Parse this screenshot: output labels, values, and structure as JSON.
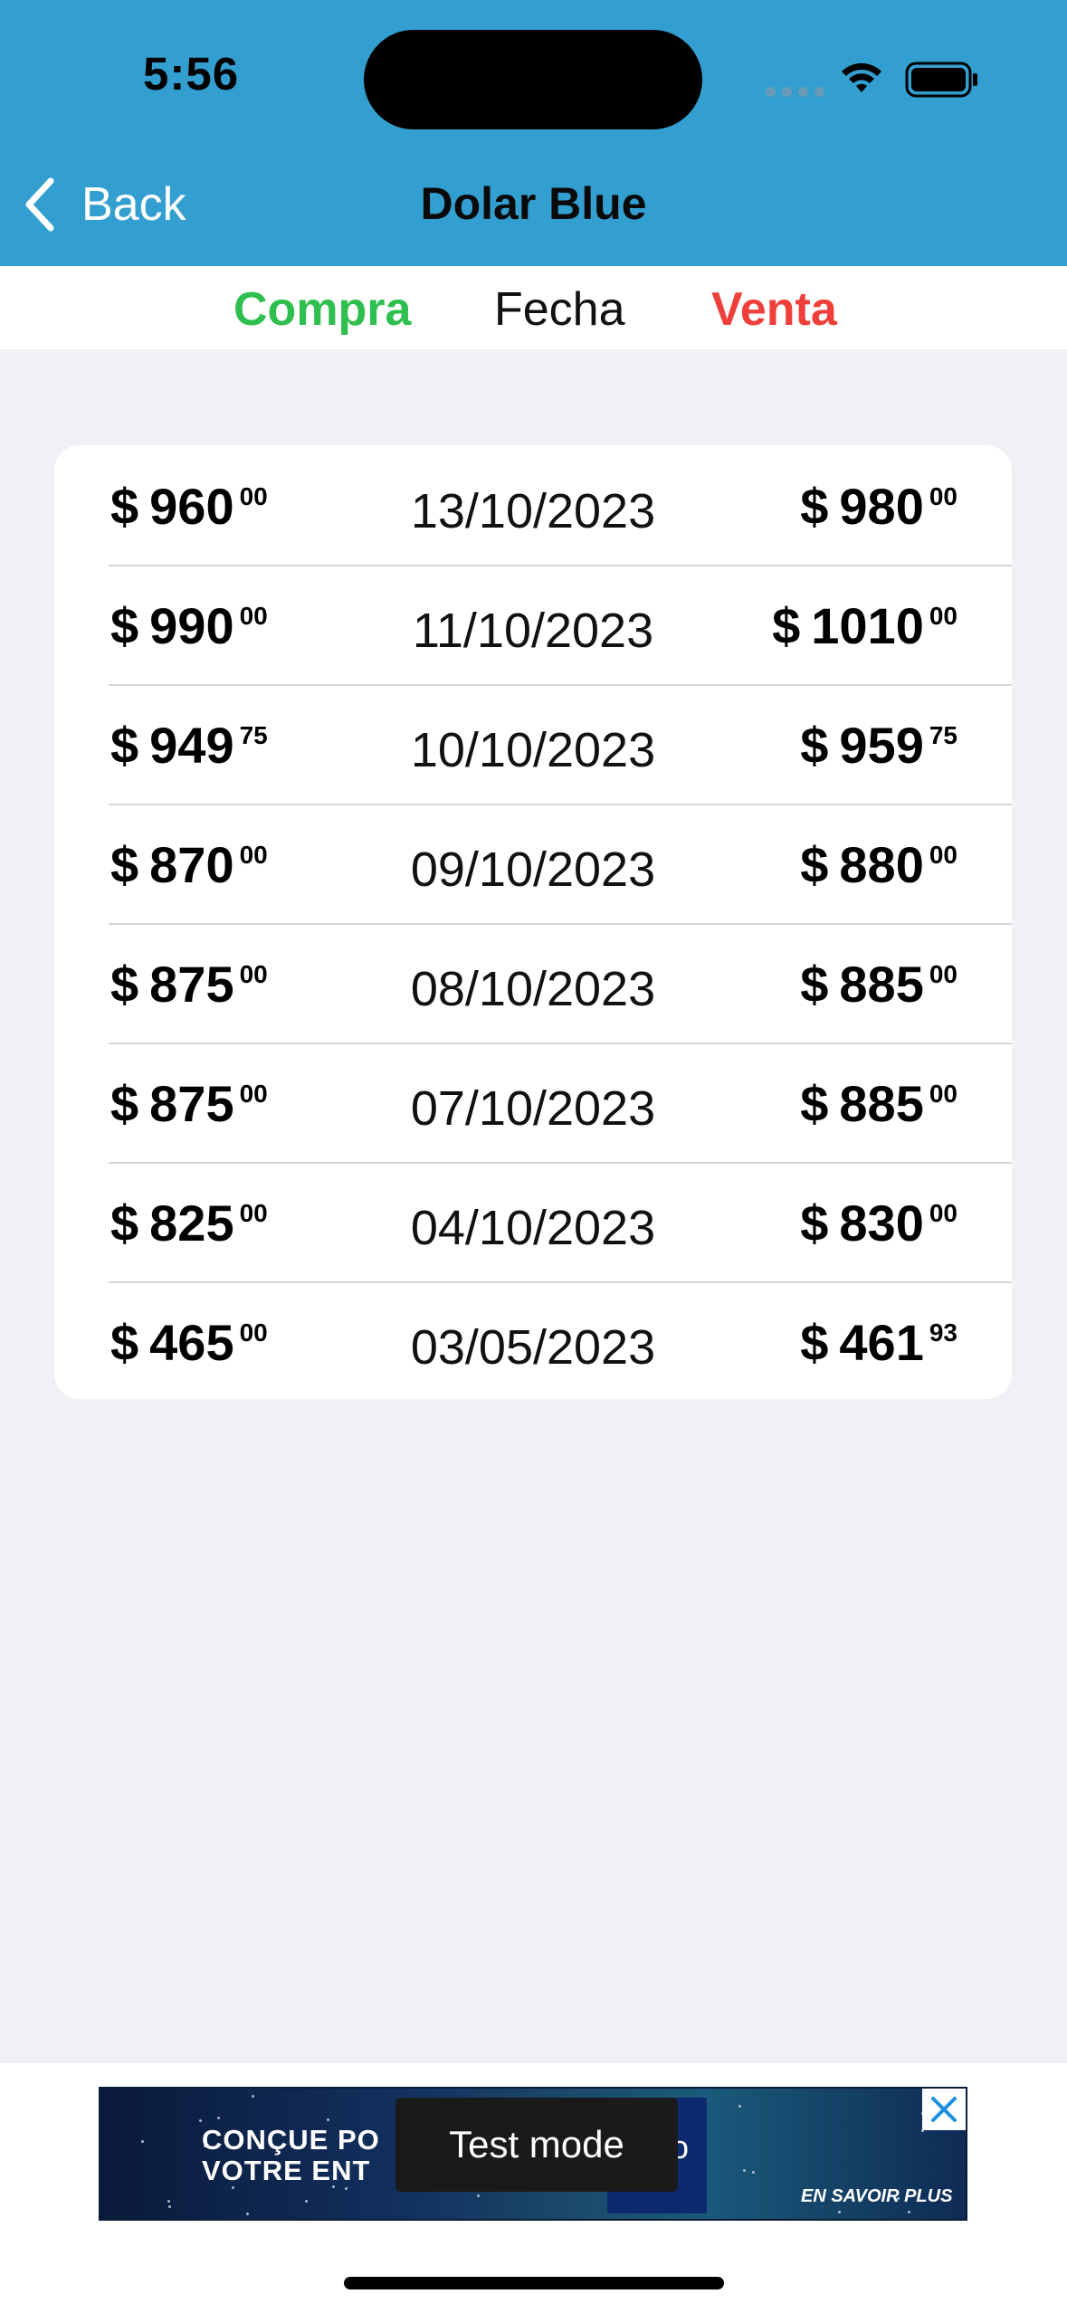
{
  "status_bar": {
    "time": "5:56",
    "icons": [
      "cellular-dots-icon",
      "wifi-icon",
      "battery-icon"
    ]
  },
  "nav": {
    "back_label": "Back",
    "title": "Dolar Blue"
  },
  "columns": {
    "buy": "Compra",
    "date": "Fecha",
    "sell": "Venta"
  },
  "colors": {
    "header_bg": "#339fd0",
    "buy": "#2fbf4f",
    "sell": "#ef3f3a",
    "background": "#f0f0f5"
  },
  "currency_symbol": "$",
  "rates": [
    {
      "buy_int": "960",
      "buy_dec": "00",
      "date": "13/10/2023",
      "sell_int": "980",
      "sell_dec": "00"
    },
    {
      "buy_int": "990",
      "buy_dec": "00",
      "date": "11/10/2023",
      "sell_int": "1010",
      "sell_dec": "00"
    },
    {
      "buy_int": "949",
      "buy_dec": "75",
      "date": "10/10/2023",
      "sell_int": "959",
      "sell_dec": "75"
    },
    {
      "buy_int": "870",
      "buy_dec": "00",
      "date": "09/10/2023",
      "sell_int": "880",
      "sell_dec": "00"
    },
    {
      "buy_int": "875",
      "buy_dec": "00",
      "date": "08/10/2023",
      "sell_int": "885",
      "sell_dec": "00"
    },
    {
      "buy_int": "875",
      "buy_dec": "00",
      "date": "07/10/2023",
      "sell_int": "885",
      "sell_dec": "00"
    },
    {
      "buy_int": "825",
      "buy_dec": "00",
      "date": "04/10/2023",
      "sell_int": "830",
      "sell_dec": "00"
    },
    {
      "buy_int": "465",
      "buy_dec": "00",
      "date": "03/05/2023",
      "sell_int": "461",
      "sell_dec": "93"
    }
  ],
  "ad": {
    "headline_line1": "CONÇUE PO",
    "headline_line2": "VOTRE ENT",
    "test_mode": "Test mode",
    "inner_text": "o",
    "cta": "EN SAVOIR PLUS"
  }
}
